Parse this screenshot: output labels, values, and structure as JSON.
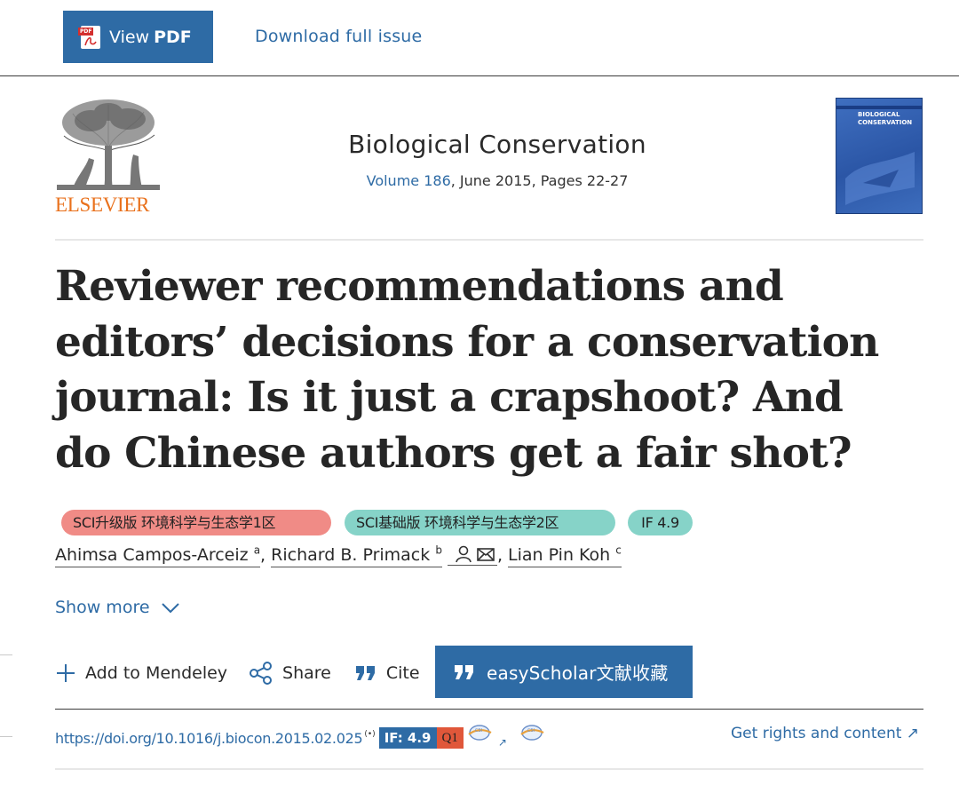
{
  "toolbar": {
    "view_pdf_prefix": "View",
    "view_pdf_bold": "PDF",
    "pdf_icon_tag": "PDF",
    "download_issue": "Download full issue"
  },
  "publisher": {
    "logo_text": "ELSEVIER"
  },
  "journal": {
    "title": "Biological Conservation",
    "volume": "Volume 186",
    "details": ", June 2015, Pages 22-27",
    "cover_title": "BIOLOGICAL\nCONSERVATION"
  },
  "article": {
    "title": "Reviewer recommendations and editors’ decisions for a conservation journal: Is it just a crapshoot? And do Chinese authors get a fair shot?"
  },
  "badges": {
    "sci_upgrade": "SCI升级版 环境科学与生态学1区",
    "sci_basic": "SCI基础版 环境科学与生态学2区",
    "impact": "IF 4.9"
  },
  "authors": [
    {
      "name": "Ahimsa Campos-Arceiz",
      "sup": "a"
    },
    {
      "name": "Richard B. Primack",
      "sup": "b"
    },
    {
      "name": "Lian Pin Koh",
      "sup": "c"
    }
  ],
  "author_sep": ", ",
  "show_more": "Show more",
  "actions": {
    "mendeley": "Add to Mendeley",
    "share": "Share",
    "cite": "Cite",
    "easyscholar": "easyScholar文献收藏"
  },
  "doi_row": {
    "doi": "https://doi.org/10.1016/j.biocon.2015.02.025",
    "radio": "(•)",
    "if_label": "IF: 4.9",
    "q_label": "Q1",
    "arrow": "↗",
    "rights": "Get rights and content ↗"
  },
  "colors": {
    "accent": "#2e6ba5",
    "badge_red": "#f08b86",
    "badge_teal": "#86d3c8",
    "q1": "#e0573a",
    "elsevier_orange": "#e9711c"
  }
}
